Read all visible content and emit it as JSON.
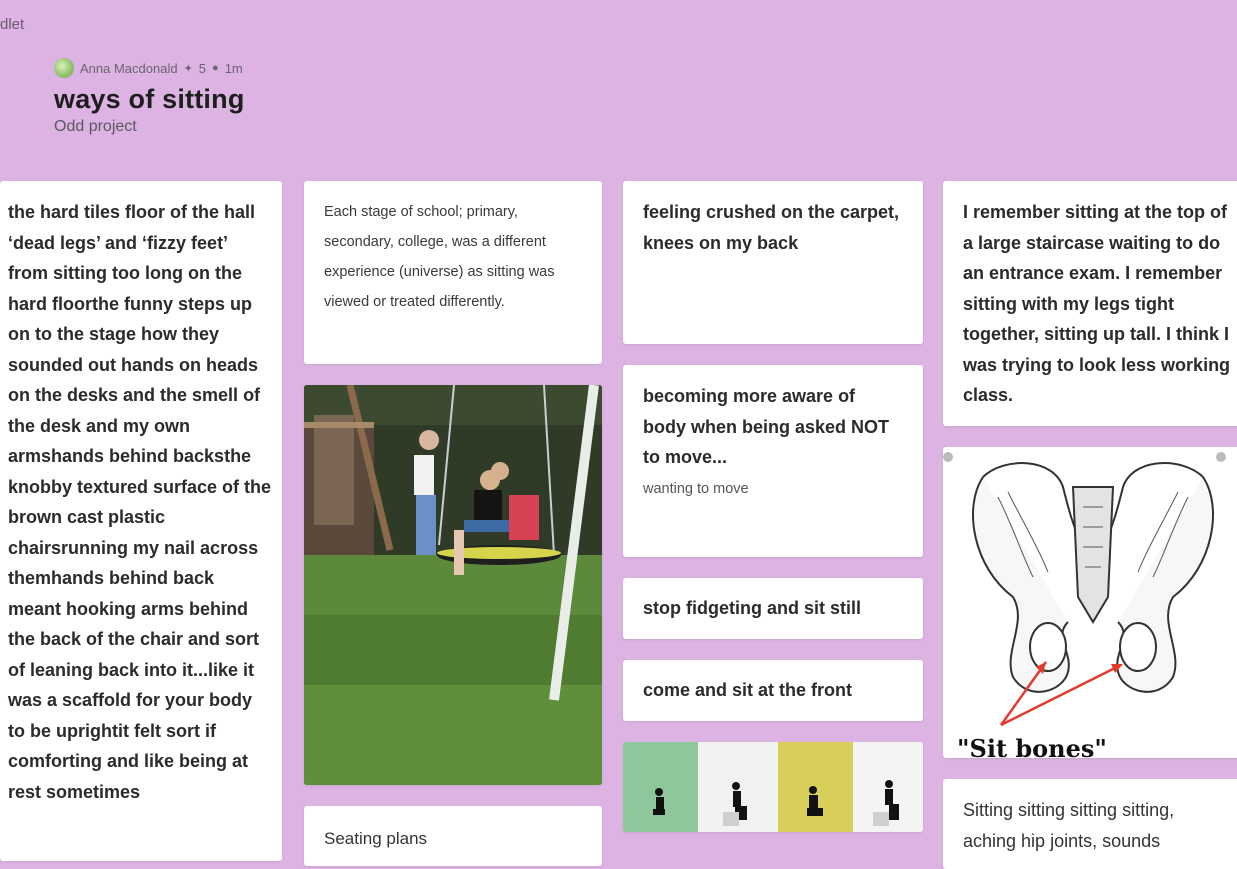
{
  "app": {
    "brand_fragment": "dlet"
  },
  "header": {
    "author": "Anna Macdonald",
    "likes_icon": "plus-icon",
    "likes": "5",
    "time": "1m",
    "title": "ways of sitting",
    "subtitle": "Odd project"
  },
  "columns": {
    "col1": {
      "post1": "the hard tiles floor of the hall ‘dead legs’ and ‘fizzy feet’ from sitting too long on the hard floorthe funny steps up on to the stage how they sounded out hands on heads on the desks and the smell of the desk and my own armshands behind backsthe knobby textured surface of the brown cast plastic chairsrunning my nail across themhands behind back meant hooking arms behind the back of the chair and sort of leaning back into it...like it was a scaffold for your body to be uprightit felt sort if comforting and like being at rest sometimes"
    },
    "col2": {
      "post1": "Each stage of school; primary, secondary, college, was a different experience (universe) as sitting was viewed or treated differently.",
      "post3": "Seating plans"
    },
    "col3": {
      "post1": "feeling crushed on the carpet, knees on my back",
      "post2_title": "becoming more aware of body when being asked NOT to move...",
      "post2_body": "wanting to move",
      "post3": "stop fidgeting and sit still",
      "post4": "come and sit at the front"
    },
    "col4": {
      "post1": "I remember sitting at the top of a large staircase waiting to do an entrance exam. I remember sitting with my legs tight together, sitting up tall. I think I was trying to look less working class.",
      "post2_caption": "\"Sit bones\"",
      "post3": "Sitting sitting sitting sitting, aching hip joints, sounds"
    }
  }
}
